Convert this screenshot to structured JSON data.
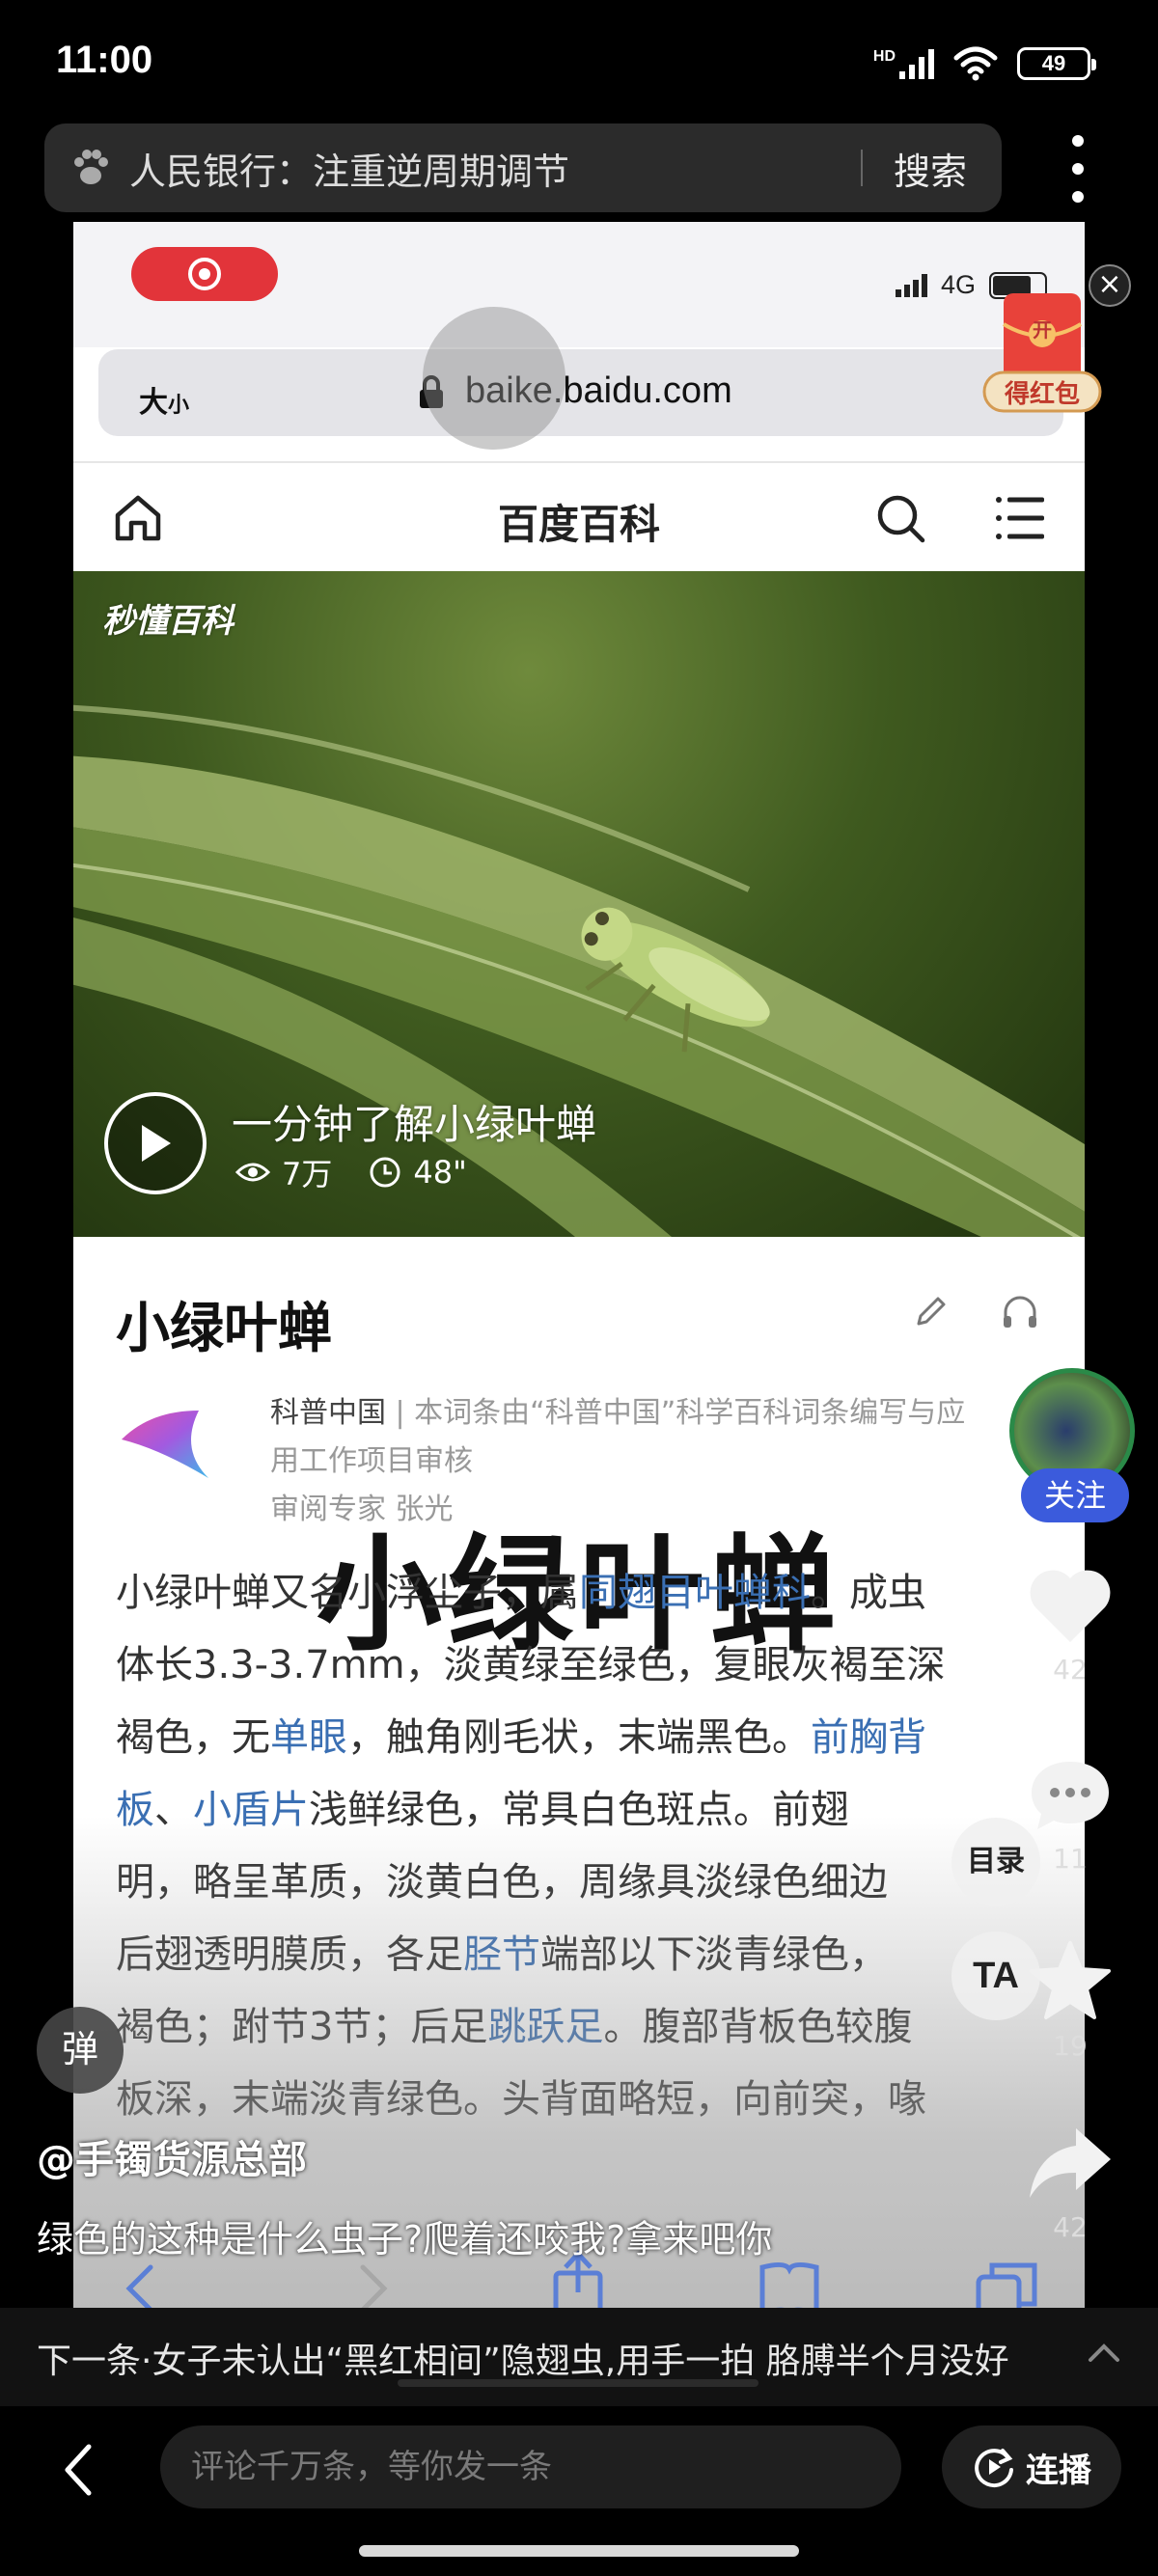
{
  "status_bar": {
    "time": "11:00",
    "network": "HD",
    "battery": "49"
  },
  "search": {
    "query": "人民银行：注重逆周期调节",
    "button": "搜索"
  },
  "video": {
    "inner_status": {
      "network": "4G"
    },
    "url_bar": {
      "size_label": "大",
      "size_small": "小",
      "url": "baike.baidu.com"
    },
    "nav": {
      "title": "百度百科"
    },
    "hero": {
      "watermark": "秒懂百科",
      "caption": "一分钟了解小绿叶蝉",
      "views": "7万",
      "duration": "48\""
    },
    "article": {
      "title": "小绿叶蝉",
      "source_name": "科普中国",
      "source_line1": " | 本词条由“科普中国”科学百科词条编写与应",
      "source_line2": "用工作项目审核",
      "source_line3": "审阅专家 张光",
      "overlay": "小绿叶蝉",
      "lines": [
        [
          "小绿叶蝉又名小浮尘子，属",
          "同翅目叶蝉科",
          "。成虫"
        ],
        [
          "体长3.3-3.7mm，淡黄绿至绿色，复眼灰褐至深"
        ],
        [
          "褐色，无",
          "单眼",
          "，触角刚毛状，末端黑色。",
          "前胸背"
        ],
        [
          "板",
          "、",
          "小盾片",
          "浅鲜绿色，常具白色斑点。前翅"
        ],
        [
          "明，略呈革质，淡黄白色，周缘具淡绿色细边"
        ],
        [
          "后翅透明膜质，各足",
          "胫节",
          "端部以下淡青绿色，"
        ],
        [
          "褐色；跗节3节；后足",
          "跳跃足",
          "。腹部背板色较腹"
        ],
        [
          "板深，末端淡青绿色。头背面略短，向前突，喙"
        ]
      ]
    }
  },
  "overlay": {
    "red_packet": {
      "top": "开",
      "label": "得红包"
    },
    "follow": "关注",
    "likes": "42",
    "comments": "11",
    "favorites": "19",
    "shares": "42",
    "catalog": "目录",
    "ta_label": "TA",
    "danmu": "弹",
    "author": "@手镯货源总部",
    "description": "绿色的这种是什么虫子?爬着还咬我?拿来吧你",
    "next": "下一条·女子未认出“黑红相间”隐翅虫,用手一拍 胳膊半个月没好"
  },
  "comment_bar": {
    "placeholder": "评论千万条，等你发一条",
    "continuous": "连播"
  },
  "colors": {
    "link": "#3a6fb3",
    "follow": "#3b5bdc",
    "record": "#e2343a"
  }
}
